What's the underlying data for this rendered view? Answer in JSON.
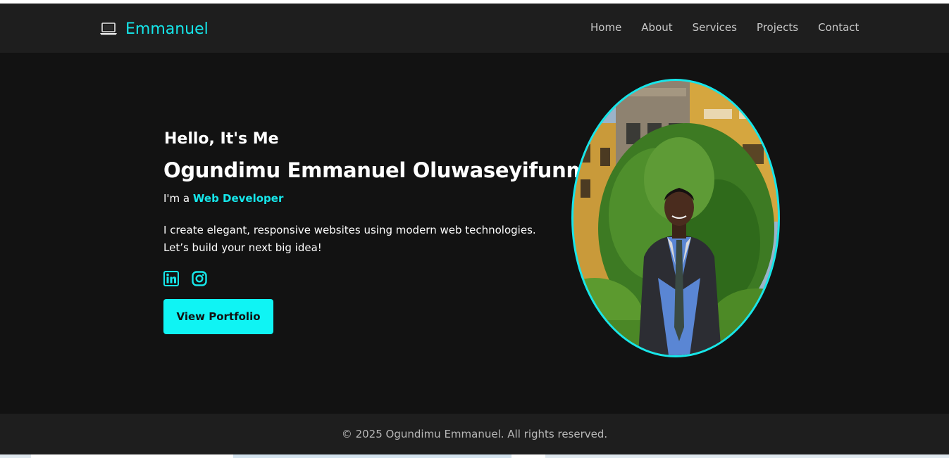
{
  "brand": {
    "icon": "laptop-icon",
    "name": "Emmanuel"
  },
  "nav": {
    "items": [
      {
        "label": "Home"
      },
      {
        "label": "About"
      },
      {
        "label": "Services"
      },
      {
        "label": "Projects"
      },
      {
        "label": "Contact"
      }
    ]
  },
  "hero": {
    "greeting": "Hello, It's Me",
    "name": "Ogundimu Emmanuel Oluwaseyifunmi",
    "role_prefix": "I'm a ",
    "role": "Web Developer",
    "description_line1": "I create elegant, responsive websites using modern web technologies.",
    "description_line2": "Let’s build your next big idea!",
    "socials": [
      {
        "icon": "linkedin-icon"
      },
      {
        "icon": "instagram-icon"
      }
    ],
    "cta_label": "View Portfolio"
  },
  "footer": {
    "text": "© 2025 Ogundimu Emmanuel. All rights reserved."
  },
  "colors": {
    "accent": "#16e6ea",
    "background": "#121212",
    "navbar": "#1e1e1e"
  }
}
